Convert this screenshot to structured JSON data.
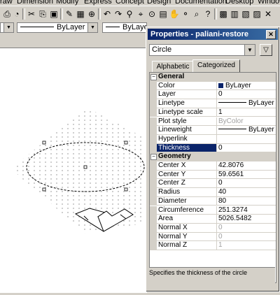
{
  "menu": [
    "raw",
    "Dimension",
    "Modify",
    "Express",
    "Concept",
    "Design",
    "Documentation",
    "Desktop",
    "Window"
  ],
  "layer_combo": "ByLayer",
  "linetype_combo": "ByLayer",
  "properties": {
    "title": "Properties - paliani-restore",
    "object_type": "Circle",
    "tabs": [
      "Alphabetic",
      "Categorized"
    ],
    "active_tab": "Categorized",
    "categories": [
      {
        "name": "General",
        "rows": [
          {
            "name": "Color",
            "value": "ByLayer",
            "swatch": "#0a246a"
          },
          {
            "name": "Layer",
            "value": "0"
          },
          {
            "name": "Linetype",
            "value": "ByLayer",
            "line": true
          },
          {
            "name": "Linetype scale",
            "value": "1"
          },
          {
            "name": "Plot style",
            "value": "ByColor",
            "gray": true
          },
          {
            "name": "Lineweight",
            "value": "ByLayer",
            "line": true
          },
          {
            "name": "Hyperlink",
            "value": ""
          },
          {
            "name": "Thickness",
            "value": "0",
            "selected": true
          }
        ]
      },
      {
        "name": "Geometry",
        "rows": [
          {
            "name": "Center X",
            "value": "42.8076"
          },
          {
            "name": "Center Y",
            "value": "59.6561"
          },
          {
            "name": "Center Z",
            "value": "0"
          },
          {
            "name": "Radius",
            "value": "40"
          },
          {
            "name": "Diameter",
            "value": "80"
          },
          {
            "name": "Circumference",
            "value": "251.3274"
          },
          {
            "name": "Area",
            "value": "5026.5482"
          },
          {
            "name": "Normal X",
            "value": "0",
            "gray": true
          },
          {
            "name": "Normal Y",
            "value": "0",
            "gray": true
          },
          {
            "name": "Normal Z",
            "value": "1",
            "gray": true
          }
        ]
      }
    ],
    "description": "Specifies the thickness of the circle"
  }
}
